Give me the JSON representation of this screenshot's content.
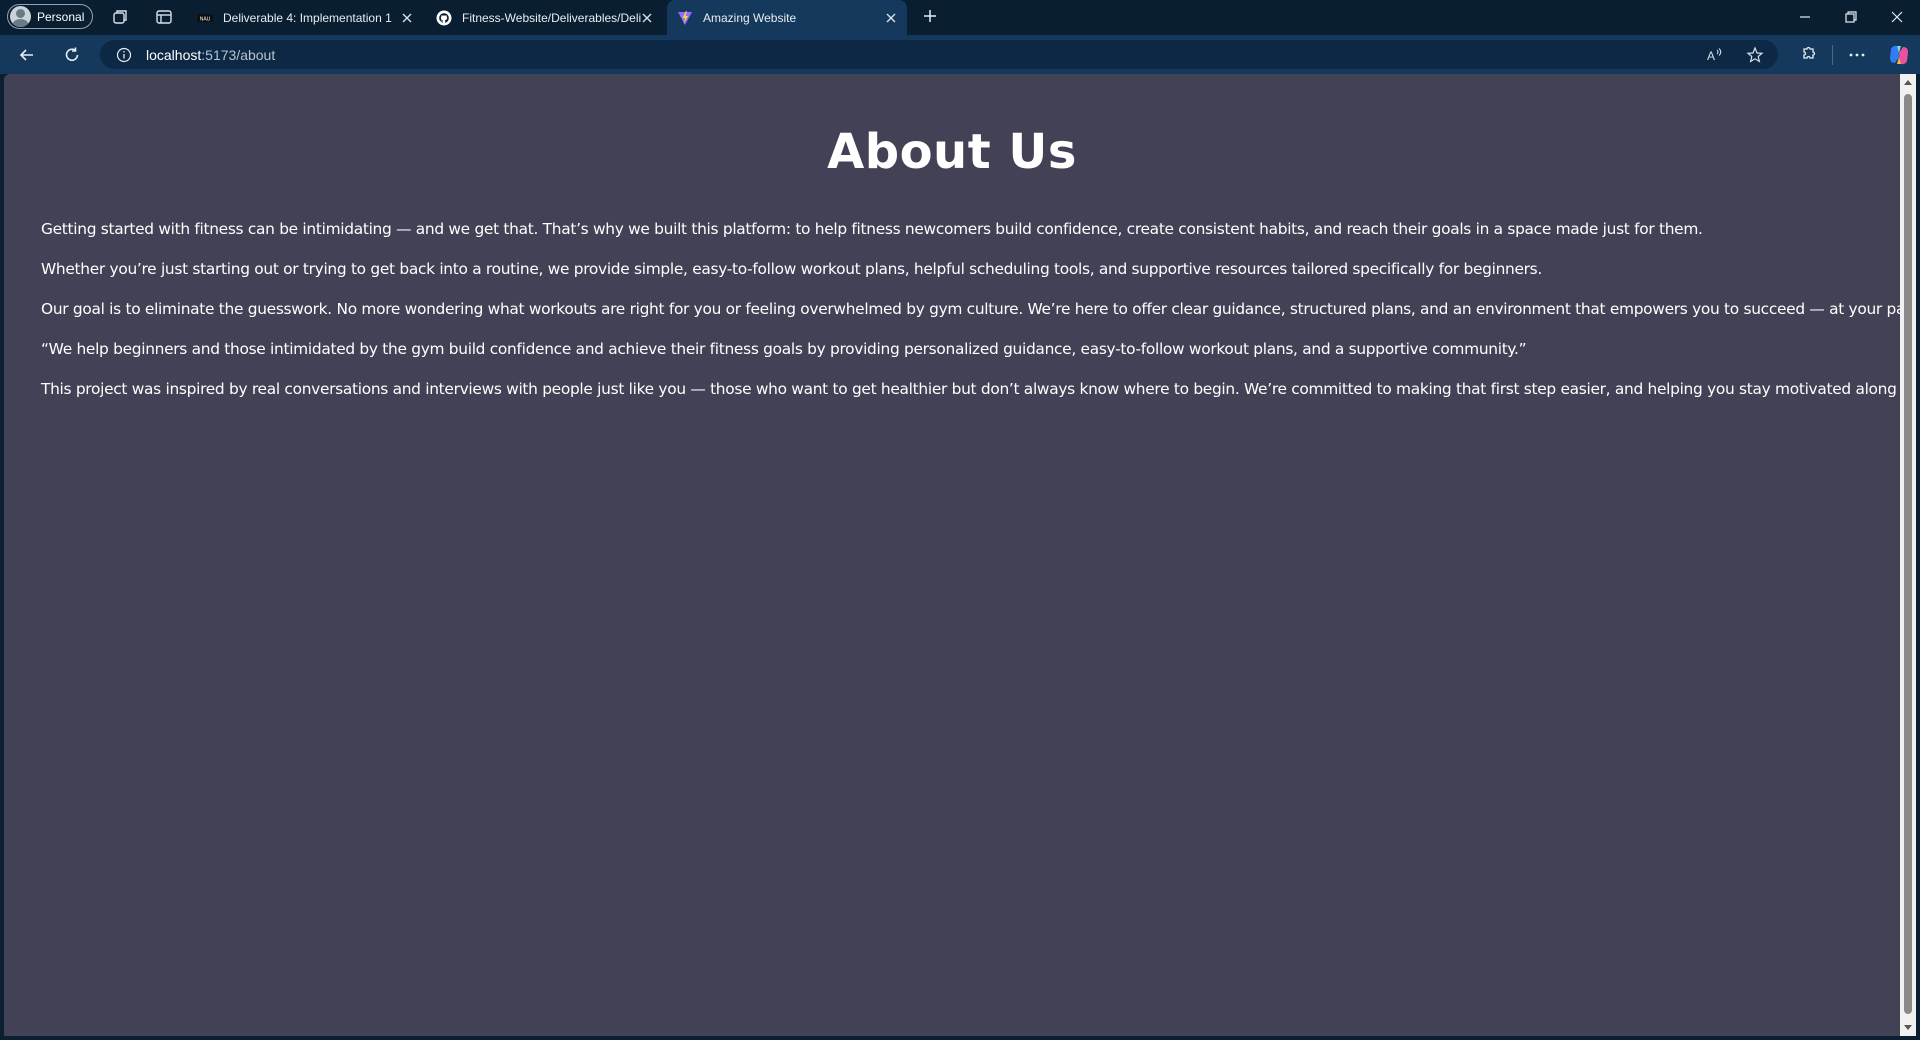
{
  "browser": {
    "profile_label": "Personal",
    "tabs": [
      {
        "title": "Deliverable 4: Implementation 1",
        "favicon": "canvas-icon",
        "active": false
      },
      {
        "title": "Fitness-Website/Deliverables/Deli",
        "favicon": "github-icon",
        "active": false
      },
      {
        "title": "Amazing Website",
        "favicon": "vite-icon",
        "active": true
      }
    ],
    "address": {
      "host": "localhost",
      "path": ":5173/about"
    }
  },
  "page": {
    "title": "About Us",
    "paragraphs": [
      "Getting started with fitness can be intimidating — and we get that. That’s why we built this platform: to help fitness newcomers build confidence, create consistent habits, and reach their goals in a space made just for them.",
      "Whether you’re just starting out or trying to get back into a routine, we provide simple, easy-to-follow workout plans, helpful scheduling tools, and supportive resources tailored specifically for beginners.",
      "Our goal is to eliminate the guesswork. No more wondering what workouts are right for you or feeling overwhelmed by gym culture. We’re here to offer clear guidance, structured plans, and an environment that empowers you to succeed — at your pace.",
      "“We help beginners and those intimidated by the gym build confidence and achieve their fitness goals by providing personalized guidance, easy-to-follow workout plans, and a supportive community.”",
      "This project was inspired by real conversations and interviews with people just like you — those who want to get healthier but don’t always know where to begin. We’re committed to making that first step easier, and helping you stay motivated along the way."
    ]
  },
  "colors": {
    "page_background": "#424155",
    "browser_frame": "#0a1e31",
    "toolbar": "#15395c",
    "text": "#ffffff"
  }
}
